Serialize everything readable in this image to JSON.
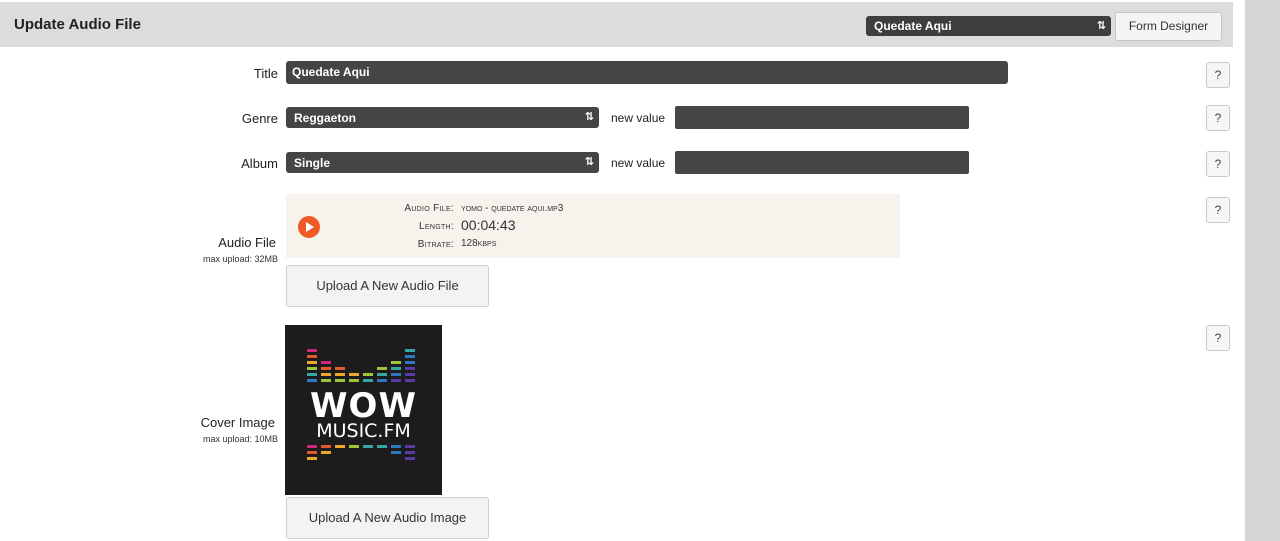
{
  "header": {
    "title": "Update Audio File",
    "record_select": "Quedate Aqui",
    "form_designer": "Form Designer"
  },
  "fields": {
    "title": {
      "label": "Title",
      "value": "Quedate Aqui"
    },
    "genre": {
      "label": "Genre",
      "value": "Reggaeton",
      "new_value_label": "new value"
    },
    "album": {
      "label": "Album",
      "value": "Single",
      "new_value_label": "new value"
    },
    "audio_file": {
      "label": "Audio File",
      "sublabel": "max upload: 32MB",
      "meta": [
        {
          "key": "Audio File:",
          "value": "yomo - quedate aqui.mp3"
        },
        {
          "key": "Length:",
          "value": "00:04:43"
        },
        {
          "key": "Bitrate:",
          "value": "128kbps"
        }
      ],
      "upload_button": "Upload A New Audio File"
    },
    "cover_image": {
      "label": "Cover Image",
      "sublabel": "max upload: 10MB",
      "image_text": [
        "WOW",
        "MUSIC.FM"
      ],
      "upload_button": "Upload A New Audio Image"
    }
  },
  "help_label": "?",
  "icons": {
    "play": "play-icon",
    "updown": "updown-arrows-icon"
  },
  "colors": {
    "header_bg": "#dcdcdc",
    "input_bg": "#454545",
    "play": "#f05a24",
    "audio_panel": "#f5f3ec"
  }
}
